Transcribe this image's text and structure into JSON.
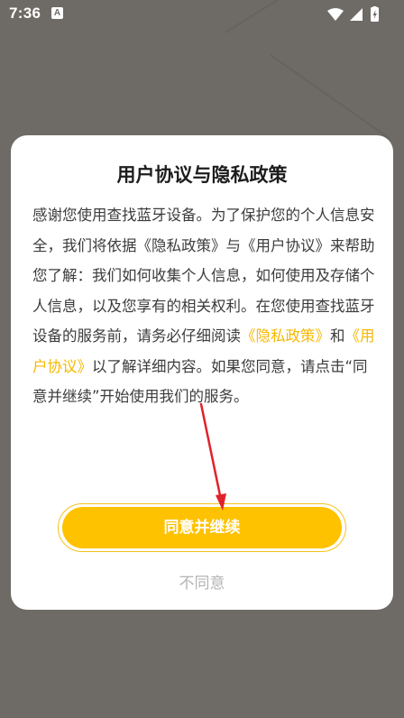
{
  "status_bar": {
    "time": "7:36",
    "notification_glyph": "A",
    "icons": [
      "wifi-icon",
      "cellular-signal-icon",
      "battery-charging-icon"
    ]
  },
  "dialog": {
    "title": "用户协议与隐私政策",
    "body": {
      "intro": "感谢您使用查找蓝牙设备。为了保护您的个人信息安全，我们将依据《隐私政策》与《用户协议》来帮助您了解：我们如何收集个人信息，如何使用及存储个人信息，以及您享有的相关权利。在您使用查找蓝牙设备的服务前，请务必仔细阅读",
      "privacy_link": "《隐私政策》",
      "conjunction": "和",
      "terms_link": "《用户协议》",
      "outro": "以了解详细内容。如果您同意，请点击“同意并继续”开始使用我们的服务。"
    },
    "agree_label": "同意并继续",
    "disagree_label": "不同意"
  },
  "colors": {
    "backdrop": "#6e6b66",
    "accent": "#fec200",
    "link": "#f5b800",
    "annotation_arrow": "#e0222a"
  }
}
